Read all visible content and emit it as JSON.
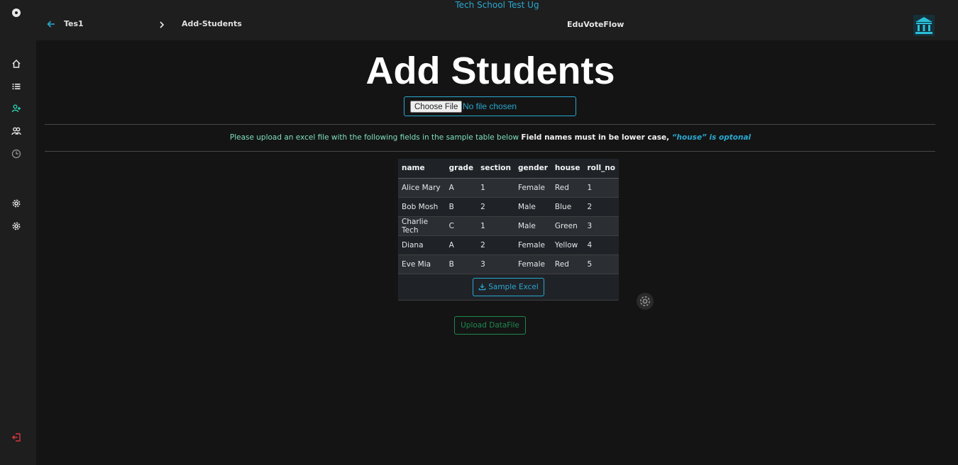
{
  "header": {
    "school_name": "Tech School Test Ug",
    "breadcrumb": [
      "Tes1",
      "Add-Students"
    ],
    "app_title": "EduVoteFlow"
  },
  "sidebar": {
    "items": [
      "menu-circle-icon",
      "home-icon",
      "list-icon",
      "add-user-icon",
      "users-icon",
      "clock-pie-icon",
      "gear-icon",
      "gear-icon",
      "logout-icon"
    ],
    "active": "add-user-icon"
  },
  "main": {
    "title": "Add Students",
    "file_input": {
      "button_label": "Choose File",
      "status": "No file chosen"
    },
    "instructions": {
      "plain": "Please upload an excel file with the following fields in the sample table below ",
      "bold": "Field names must in be lower case, ",
      "italic": "“house” is optonal"
    },
    "sample_table": {
      "columns": [
        "name",
        "grade",
        "section",
        "gender",
        "house",
        "roll_no"
      ],
      "rows": [
        [
          "Alice Mary",
          "A",
          "1",
          "Female",
          "Red",
          "1"
        ],
        [
          "Bob Mosh",
          "B",
          "2",
          "Male",
          "Blue",
          "2"
        ],
        [
          "Charlie Tech",
          "C",
          "1",
          "Male",
          "Green",
          "3"
        ],
        [
          "Diana",
          "A",
          "2",
          "Female",
          "Yellow",
          "4"
        ],
        [
          "Eve Mia",
          "B",
          "3",
          "Female",
          "Red",
          "5"
        ]
      ],
      "download_label": "Sample Excel"
    },
    "upload_label": "Upload DataFile"
  },
  "colors": {
    "accent": "#29a8d0",
    "success": "#1f9e5b",
    "instruction": "#7fe0be",
    "danger": "#d9363e"
  }
}
